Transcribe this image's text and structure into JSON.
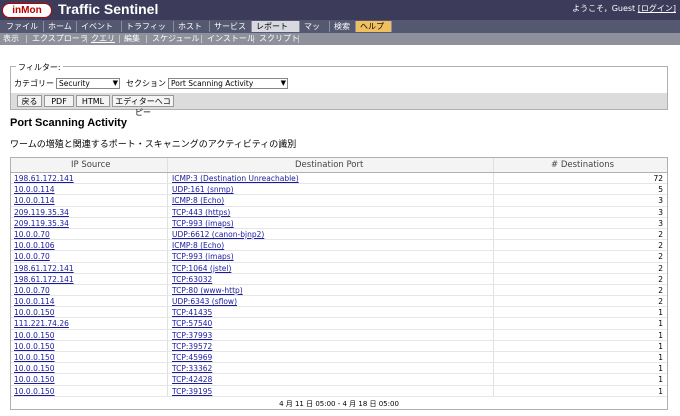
{
  "header": {
    "logo_text": "inMon",
    "app_title": "Traffic Sentinel",
    "welcome_text": "ようこそ，Guest",
    "login_link": "[ログイン]"
  },
  "menu": [
    {
      "label": "ファイル"
    },
    {
      "label": "ホーム"
    },
    {
      "label": "イベント"
    },
    {
      "label": "トラフィック"
    },
    {
      "label": "ホスト"
    },
    {
      "label": "サービス"
    },
    {
      "label": "レポート"
    },
    {
      "label": "マップ"
    },
    {
      "label": "検索"
    },
    {
      "label": "ヘルプ"
    }
  ],
  "submenu": [
    {
      "label": "表示"
    },
    {
      "label": "エクスプローラ"
    },
    {
      "label": "クエリ"
    },
    {
      "label": "編集"
    },
    {
      "label": "スケジュール"
    },
    {
      "label": "インストール"
    },
    {
      "label": "スクリプト"
    }
  ],
  "filter": {
    "legend": "フィルター:",
    "category_label": "カテゴリー",
    "category_value": "Security",
    "section_label": "セクション",
    "section_value": "Port Scanning Activity"
  },
  "buttons": {
    "back": "戻る",
    "pdf": "PDF",
    "html": "HTML",
    "copy_to_editor": "エディターへコピー"
  },
  "page": {
    "title": "Port Scanning Activity",
    "description": "ワームの増殖と関連するポート・スキャニングのアクティビティの識別"
  },
  "table": {
    "columns": [
      "IP Source",
      "Destination Port",
      "# Destinations"
    ],
    "rows": [
      [
        "198.61.172.141",
        "ICMP:3 (Destination Unreachable)",
        "72"
      ],
      [
        "10.0.0.114",
        "UDP:161 (snmp)",
        "5"
      ],
      [
        "10.0.0.114",
        "ICMP:8 (Echo)",
        "3"
      ],
      [
        "209.119.35.34",
        "TCP:443 (https)",
        "3"
      ],
      [
        "209.119.35.34",
        "TCP:993 (imaps)",
        "3"
      ],
      [
        "10.0.0.70",
        "UDP:6612 (canon-bjnp2)",
        "2"
      ],
      [
        "10.0.0.106",
        "ICMP:8 (Echo)",
        "2"
      ],
      [
        "10.0.0.70",
        "TCP:993 (imaps)",
        "2"
      ],
      [
        "198.61.172.141",
        "TCP:1064 (jstel)",
        "2"
      ],
      [
        "198.61.172.141",
        "TCP:63032",
        "2"
      ],
      [
        "10.0.0.70",
        "TCP:80 (www-http)",
        "2"
      ],
      [
        "10.0.0.114",
        "UDP:6343 (sflow)",
        "2"
      ],
      [
        "10.0.0.150",
        "TCP:41435",
        "1"
      ],
      [
        "111.221.74.26",
        "TCP:57540",
        "1"
      ],
      [
        "10.0.0.150",
        "TCP:37993",
        "1"
      ],
      [
        "10.0.0.150",
        "TCP:39572",
        "1"
      ],
      [
        "10.0.0.150",
        "TCP:45969",
        "1"
      ],
      [
        "10.0.0.150",
        "TCP:33362",
        "1"
      ],
      [
        "10.0.0.150",
        "TCP:42428",
        "1"
      ],
      [
        "10.0.0.150",
        "TCP:39195",
        "1"
      ]
    ],
    "footer": "4 月 11 日 05:00 - 4 月 18 日 05:00"
  }
}
